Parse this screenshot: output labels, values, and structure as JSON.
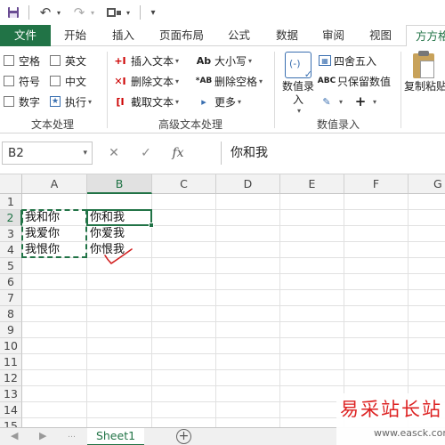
{
  "qat": {
    "save_icon": "save-icon",
    "undo_icon": "undo-icon",
    "redo_icon": "redo-icon",
    "customize_icon": "customize-icon"
  },
  "tabs": [
    {
      "label": "文件"
    },
    {
      "label": "开始"
    },
    {
      "label": "插入"
    },
    {
      "label": "页面布局"
    },
    {
      "label": "公式"
    },
    {
      "label": "数据"
    },
    {
      "label": "审阅"
    },
    {
      "label": "视图"
    },
    {
      "label": "方方格"
    }
  ],
  "ribbon": {
    "text_processing": {
      "items": [
        "空格",
        "英文",
        "符号",
        "中文",
        "数字",
        "执行"
      ],
      "label": "文本处理"
    },
    "advanced_text": {
      "insert_text": "插入文本",
      "delete_text": "删除文本",
      "extract_text": "截取文本",
      "case": "大小写",
      "delete_spaces": "删除空格",
      "more": "更多",
      "label": "高级文本处理"
    },
    "numeric_entry": {
      "big_button": "数值录入",
      "round": "四舍五入",
      "keep_value": "只保留数值",
      "label": "数值录入"
    },
    "paste": {
      "label": "复制粘贴"
    }
  },
  "formula_bar": {
    "name_box": "B2",
    "cancel": "✕",
    "enter": "✓",
    "fx": "fx",
    "formula": "你和我"
  },
  "grid": {
    "columns": [
      "A",
      "B",
      "C",
      "D",
      "E",
      "F",
      "G"
    ],
    "rows": [
      "1",
      "2",
      "3",
      "4",
      "5",
      "6",
      "7",
      "8",
      "9",
      "10",
      "11",
      "12",
      "13",
      "14",
      "15"
    ],
    "cells": {
      "A2": "我和你",
      "B2": "你和我",
      "A3": "我爱你",
      "B3": "你爱我",
      "A4": "我恨你",
      "B4": "你恨我"
    }
  },
  "sheets": [
    "Sheet1"
  ],
  "watermark": {
    "title": "易采站长站",
    "url": "www.easck.com"
  },
  "colors": {
    "accent": "#217346",
    "annotation": "#d22222"
  }
}
